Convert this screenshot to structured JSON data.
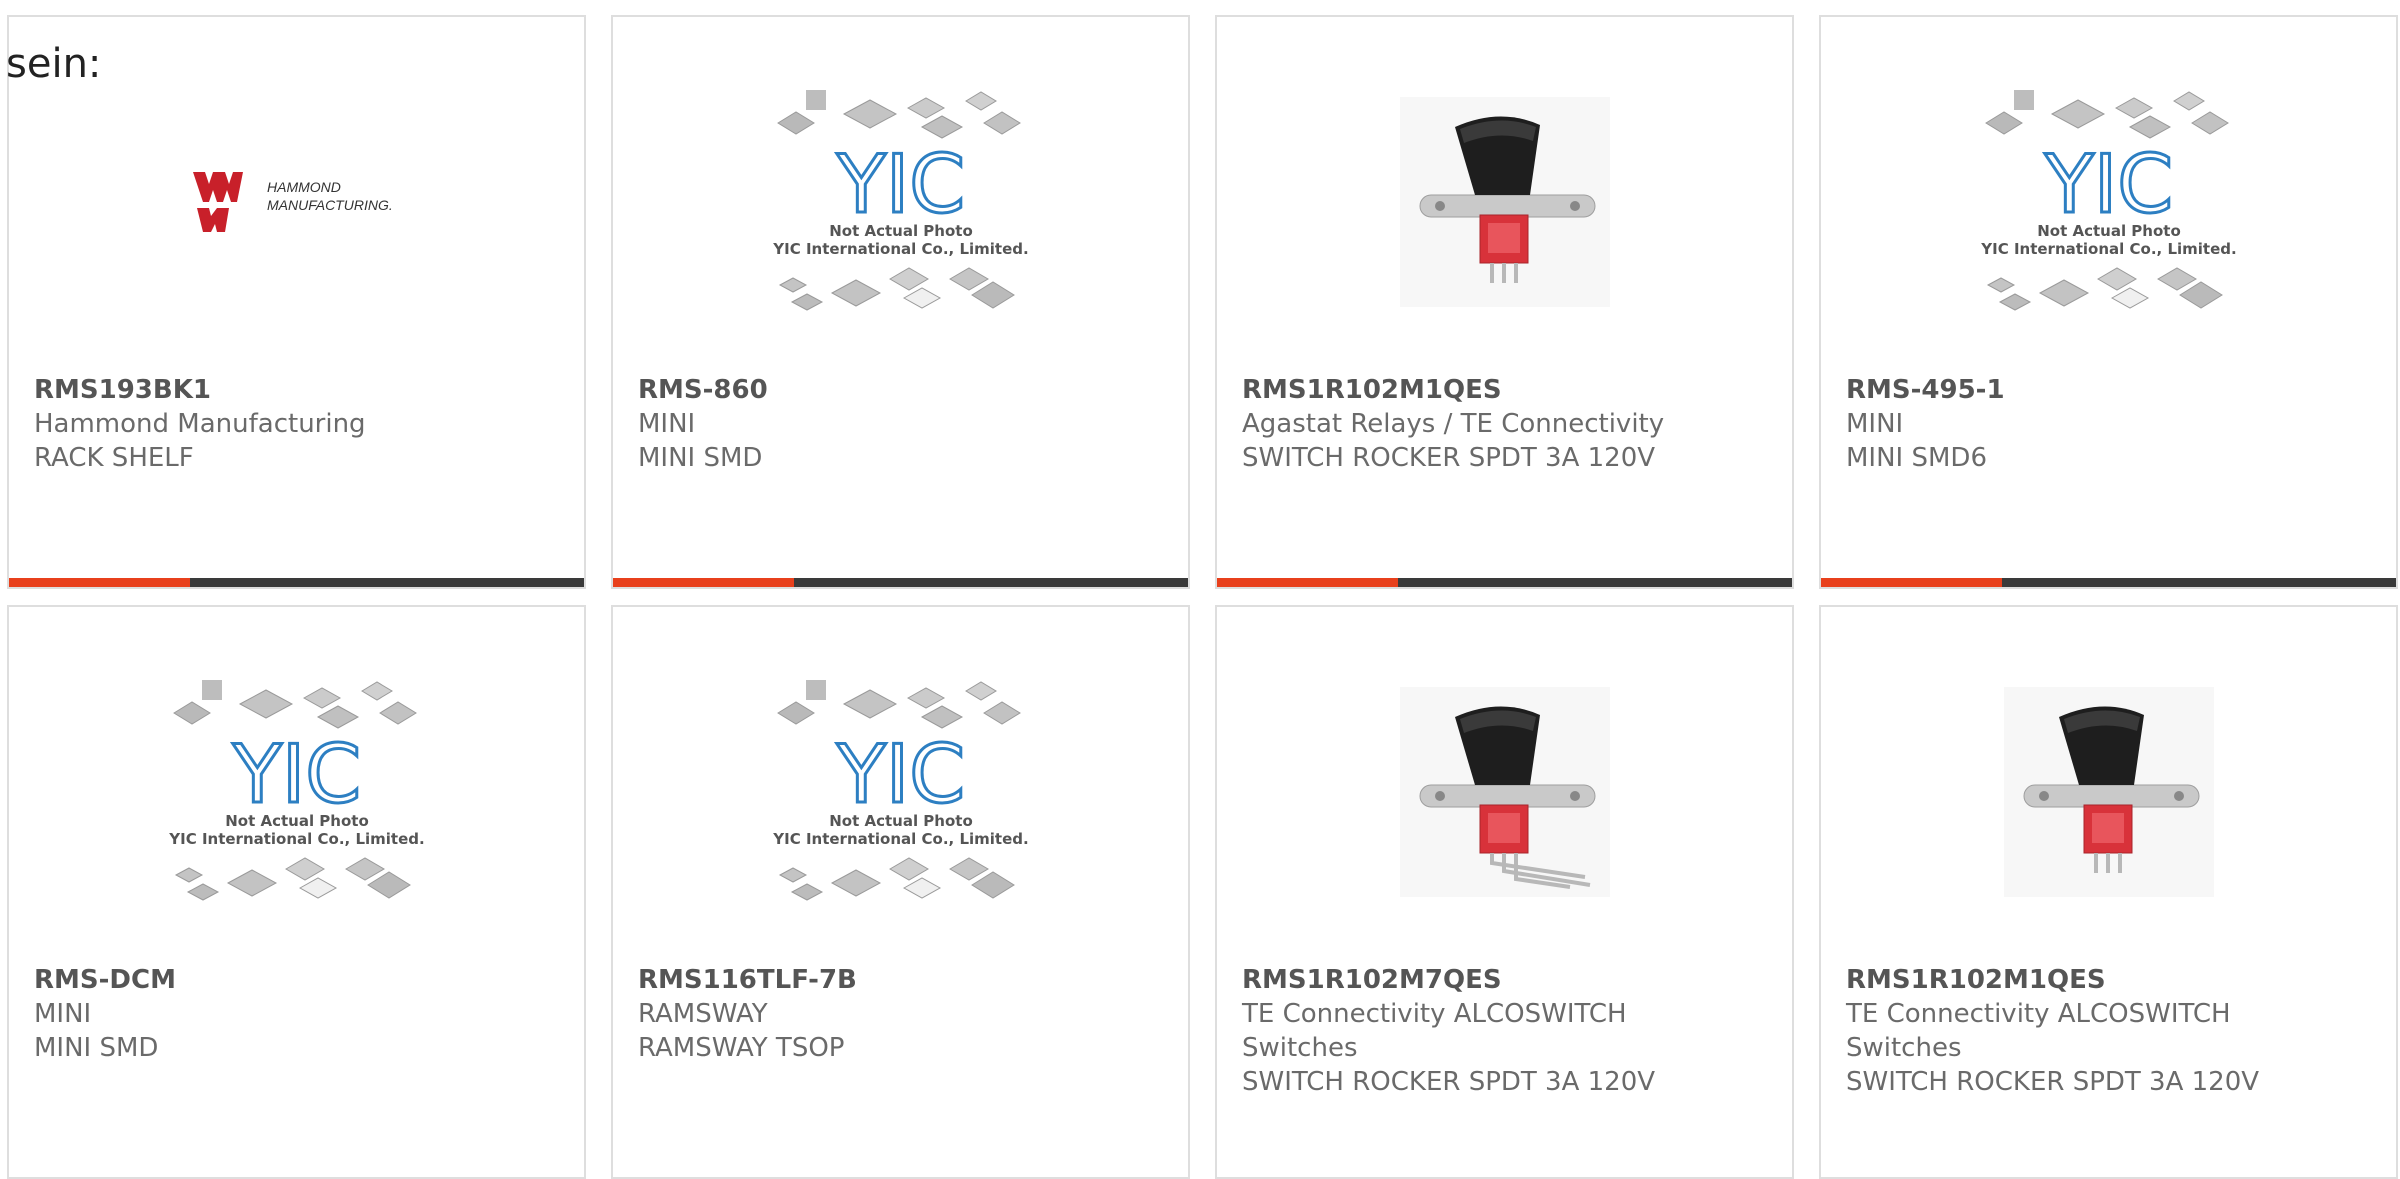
{
  "lead_text": "sein:",
  "accent_color": "#e8401c",
  "bar_color": "#3a3a3a",
  "placeholder_caption": [
    "Not Actual Photo",
    "YIC International Co., Limited."
  ],
  "placeholder_logo": "YIC",
  "hammond_logo": [
    "HAMMOND",
    "MANUFACTURING."
  ],
  "products": [
    {
      "part": "RMS193BK1",
      "lines": [
        "Hammond Manufacturing",
        "RACK SHELF"
      ],
      "image": "hammond-logo"
    },
    {
      "part": "RMS-860",
      "lines": [
        "MINI",
        "MINI SMD"
      ],
      "image": "yic-placeholder"
    },
    {
      "part": "RMS1R102M1QES",
      "lines": [
        "Agastat Relays / TE Connectivity",
        "SWITCH ROCKER SPDT 3A 120V"
      ],
      "image": "rocker-switch"
    },
    {
      "part": "RMS-495-1",
      "lines": [
        "MINI",
        "MINI SMD6"
      ],
      "image": "yic-placeholder"
    },
    {
      "part": "RMS-DCM",
      "lines": [
        "MINI",
        "MINI SMD"
      ],
      "image": "yic-placeholder"
    },
    {
      "part": "RMS116TLF-7B",
      "lines": [
        "RAMSWAY",
        "RAMSWAY TSOP"
      ],
      "image": "yic-placeholder"
    },
    {
      "part": "RMS1R102M7QES",
      "lines": [
        "TE Connectivity ALCOSWITCH",
        "Switches",
        "SWITCH ROCKER SPDT 3A 120V"
      ],
      "image": "rocker-switch-angled"
    },
    {
      "part": "RMS1R102M1QES",
      "lines": [
        "TE Connectivity ALCOSWITCH",
        "Switches",
        "SWITCH ROCKER SPDT 3A 120V"
      ],
      "image": "rocker-switch"
    }
  ]
}
